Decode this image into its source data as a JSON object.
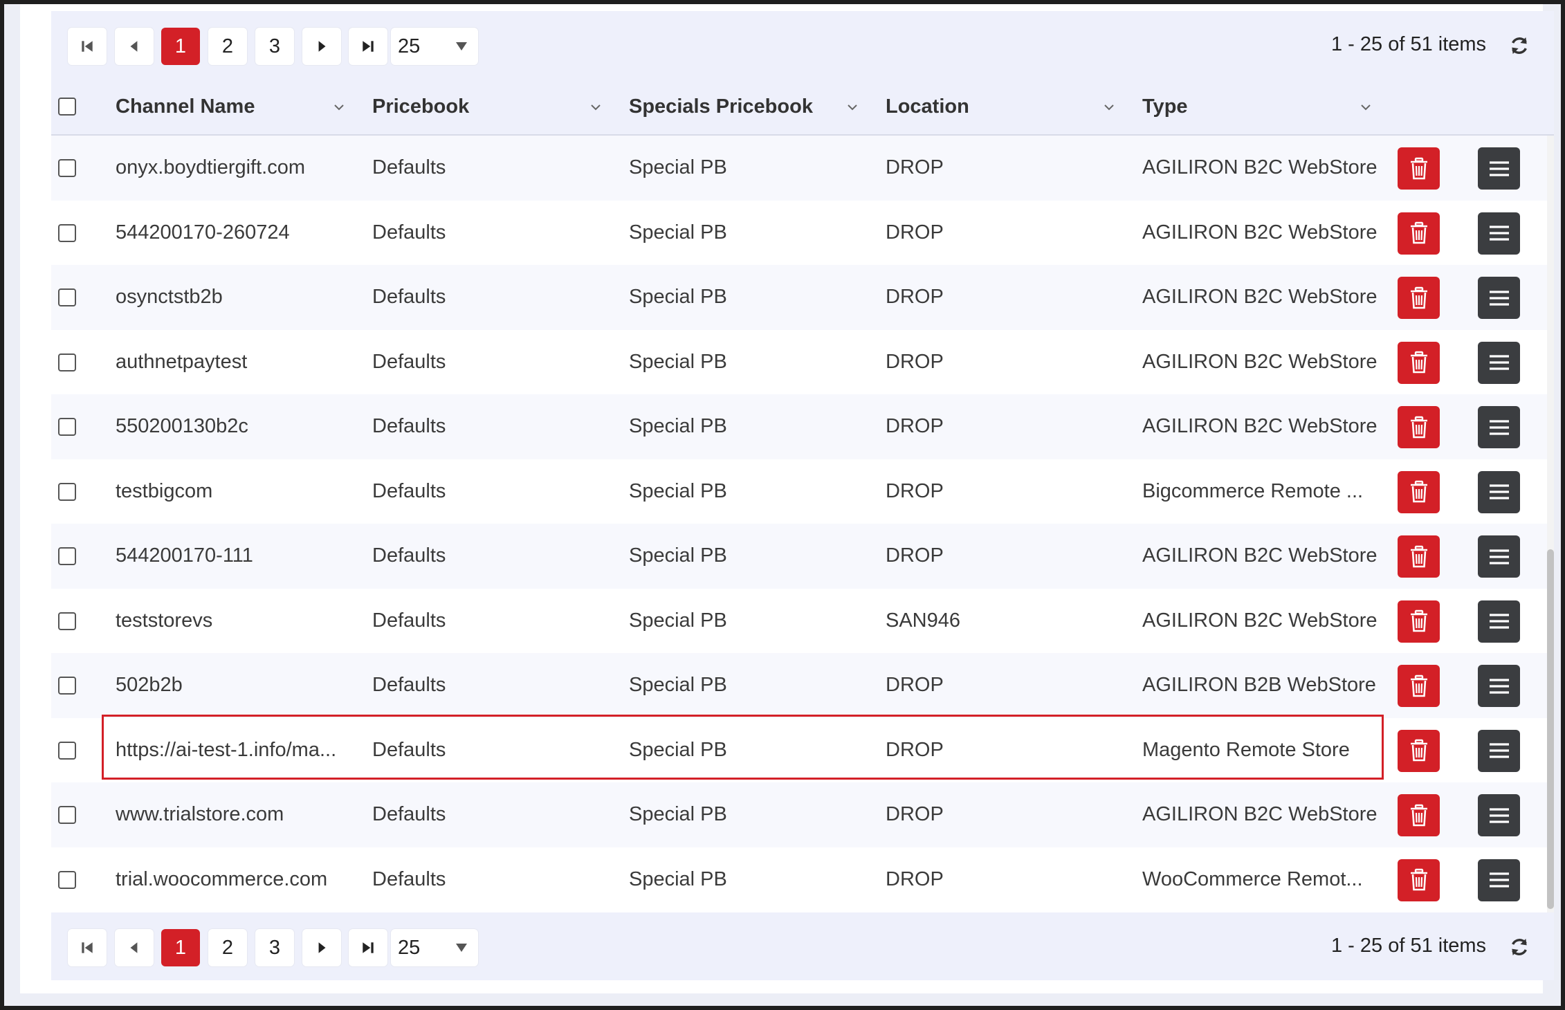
{
  "pager": {
    "pages": [
      "1",
      "2",
      "3"
    ],
    "active_page": "1",
    "page_size": "25",
    "info": "1 - 25 of 51 items"
  },
  "columns": {
    "channel_name": "Channel Name",
    "pricebook": "Pricebook",
    "specials_pricebook": "Specials Pricebook",
    "location": "Location",
    "type": "Type"
  },
  "rows": [
    {
      "channel": "onyx.boydtiergift.com",
      "pricebook": "Defaults",
      "special": "Special PB",
      "location": "DROP",
      "type": "AGILIRON B2C WebStore"
    },
    {
      "channel": "544200170-260724",
      "pricebook": "Defaults",
      "special": "Special PB",
      "location": "DROP",
      "type": "AGILIRON B2C WebStore"
    },
    {
      "channel": "osynctstb2b",
      "pricebook": "Defaults",
      "special": "Special PB",
      "location": "DROP",
      "type": "AGILIRON B2C WebStore"
    },
    {
      "channel": "authnetpaytest",
      "pricebook": "Defaults",
      "special": "Special PB",
      "location": "DROP",
      "type": "AGILIRON B2C WebStore"
    },
    {
      "channel": "550200130b2c",
      "pricebook": "Defaults",
      "special": "Special PB",
      "location": "DROP",
      "type": "AGILIRON B2C WebStore"
    },
    {
      "channel": "testbigcom",
      "pricebook": "Defaults",
      "special": "Special PB",
      "location": "DROP",
      "type": "Bigcommerce Remote ..."
    },
    {
      "channel": "544200170-111",
      "pricebook": "Defaults",
      "special": "Special PB",
      "location": "DROP",
      "type": "AGILIRON B2C WebStore"
    },
    {
      "channel": "teststorevs",
      "pricebook": "Defaults",
      "special": "Special PB",
      "location": "SAN946",
      "type": "AGILIRON B2C WebStore"
    },
    {
      "channel": "502b2b",
      "pricebook": "Defaults",
      "special": "Special PB",
      "location": "DROP",
      "type": "AGILIRON B2B WebStore"
    },
    {
      "channel": "https://ai-test-1.info/ma...",
      "pricebook": "Defaults",
      "special": "Special PB",
      "location": "DROP",
      "type": "Magento Remote Store"
    },
    {
      "channel": "www.trialstore.com",
      "pricebook": "Defaults",
      "special": "Special PB",
      "location": "DROP",
      "type": "AGILIRON B2C WebStore"
    },
    {
      "channel": "trial.woocommerce.com",
      "pricebook": "Defaults",
      "special": "Special PB",
      "location": "DROP",
      "type": "WooCommerce Remot..."
    }
  ],
  "highlighted_row_index": 9,
  "colors": {
    "accent_red": "#d32027",
    "menu_dark": "#3b3d40",
    "header_bg": "#eef0fb"
  },
  "icons": {
    "first": "first-page-icon",
    "prev": "prev-page-icon",
    "next": "next-page-icon",
    "last": "last-page-icon",
    "refresh": "refresh-icon",
    "delete": "trash-icon",
    "menu": "hamburger-menu-icon",
    "sort": "chevron-down-icon"
  }
}
